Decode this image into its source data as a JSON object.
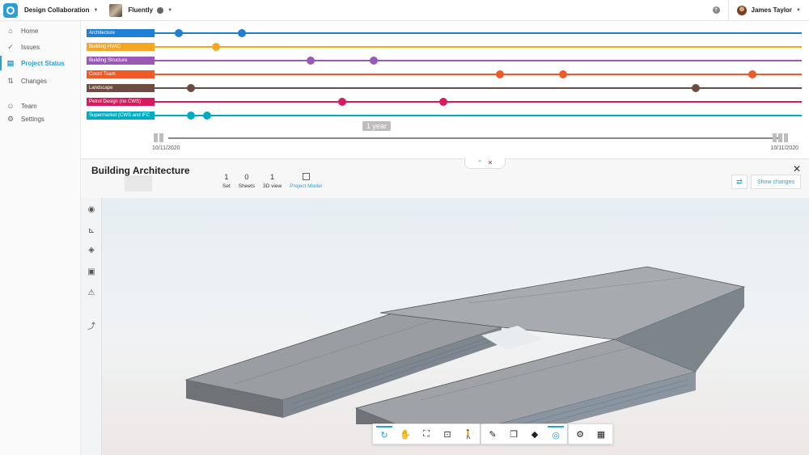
{
  "topbar": {
    "app_title": "Design Collaboration",
    "project_name": "Fluently",
    "help_label": "?",
    "user_name": "James Taylor"
  },
  "sidebar": {
    "items": [
      {
        "label": "Home",
        "icon": "home-icon",
        "glyph": "⌂"
      },
      {
        "label": "Issues",
        "icon": "check-circle-icon",
        "glyph": "✓"
      },
      {
        "label": "Project Status",
        "icon": "status-icon",
        "glyph": "▤",
        "active": true
      },
      {
        "label": "Changes",
        "icon": "swap-arrows-icon",
        "glyph": "⇅"
      },
      {
        "label": "Team",
        "icon": "team-icon",
        "glyph": "☺"
      },
      {
        "label": "Settings",
        "icon": "gear-icon",
        "glyph": "⚙"
      }
    ]
  },
  "timeline": {
    "rows": [
      {
        "label": "Architecture",
        "color": "#1f7fd4",
        "dots": [
          0.02,
          0.12
        ]
      },
      {
        "label": "Building HVAC",
        "color": "#f5a623",
        "dots": [
          0.08
        ]
      },
      {
        "label": "Building Structure",
        "color": "#9b59b6",
        "dots": [
          0.23,
          0.33
        ]
      },
      {
        "label": "Coord Team",
        "color": "#f05a28",
        "dots": [
          0.53,
          0.63,
          0.93
        ]
      },
      {
        "label": "Landscape",
        "color": "#6d4c41",
        "dots": [
          0.04,
          0.84
        ]
      },
      {
        "label": "Petrol Design (no CWS)",
        "color": "#d81b60",
        "dots": [
          0.28,
          0.44
        ]
      },
      {
        "label": "Supermarket (CWS and IFC",
        "color": "#00acc1",
        "dots": [
          0.04,
          0.065
        ]
      }
    ],
    "range_label": "1 year",
    "start_date": "10/11/2020",
    "end_date": "10/11/2020"
  },
  "panel": {
    "title": "Building Architecture",
    "stats": [
      {
        "value": "1",
        "label": "Set"
      },
      {
        "value": "0",
        "label": "Sheets"
      },
      {
        "value": "1",
        "label": "3D view"
      }
    ],
    "project_model_label": "Project Model",
    "show_changes_label": "Show changes",
    "close_glyph": "✕",
    "collapse_glyph": "⌃",
    "collapse_close_glyph": "✕"
  },
  "viewer": {
    "side_tools": [
      {
        "icon": "eye-icon",
        "glyph": "◉"
      },
      {
        "icon": "measure-icon",
        "glyph": "⊾"
      },
      {
        "icon": "layers-icon",
        "glyph": "◈"
      },
      {
        "icon": "sheet-icon",
        "glyph": "▣"
      },
      {
        "icon": "warning-icon",
        "glyph": "⚠"
      },
      {
        "icon": "split-arrow-icon",
        "glyph": "⤴"
      }
    ],
    "toolbar_groups": [
      [
        {
          "icon": "orbit-icon",
          "glyph": "↻",
          "active": true
        },
        {
          "icon": "pan-hand-icon",
          "glyph": "✋"
        },
        {
          "icon": "fit-view-icon",
          "glyph": "⛶"
        },
        {
          "icon": "camera-icon",
          "glyph": "⊡"
        },
        {
          "icon": "walk-person-icon",
          "glyph": "🚶"
        }
      ],
      [
        {
          "icon": "ruler-icon",
          "glyph": "✎"
        },
        {
          "icon": "explode-icon",
          "glyph": "❒"
        },
        {
          "icon": "section-box-icon",
          "glyph": "◆"
        },
        {
          "icon": "view-eye-icon",
          "glyph": "◎",
          "active": true
        }
      ],
      [
        {
          "icon": "settings-gear-icon",
          "glyph": "⚙"
        },
        {
          "icon": "properties-icon",
          "glyph": "▦"
        }
      ]
    ]
  }
}
